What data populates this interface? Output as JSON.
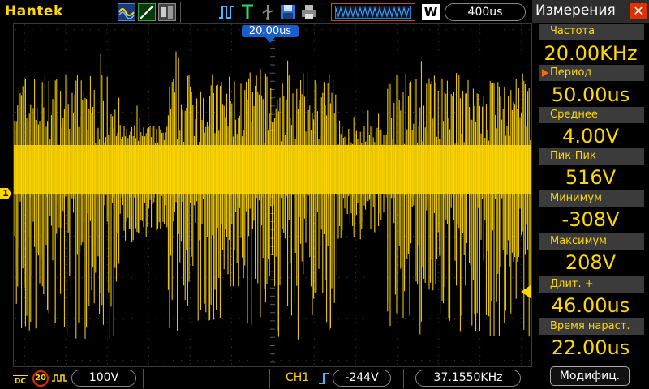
{
  "header": {
    "brand": "Hantek",
    "timebase": "400us",
    "window_mode_badge": "W"
  },
  "trigger": {
    "position_label": "20.00us"
  },
  "channel": {
    "marker_label": "1",
    "color": "#ffd800"
  },
  "measurements": {
    "title": "Измерения",
    "close_label": "✕",
    "items": [
      {
        "label": "Частота",
        "value": "20.00KHz"
      },
      {
        "label": "Период",
        "value": "50.00us"
      },
      {
        "label": "Среднее",
        "value": "4.00V"
      },
      {
        "label": "Пик-Пик",
        "value": "516V"
      },
      {
        "label": "Минимум",
        "value": "-308V"
      },
      {
        "label": "Максимум",
        "value": "208V"
      },
      {
        "label": "Длит.  +",
        "value": "46.00us"
      },
      {
        "label": "Время  нараст.",
        "value": "22.00us"
      }
    ],
    "modify_label": "Модифиц."
  },
  "status": {
    "coupling_label": "DC",
    "bw_limit_label": "20",
    "volts_per_div": "100V",
    "trigger_channel": "CH1",
    "trigger_level": "-244V",
    "trigger_frequency": "37.1550KHz"
  },
  "icons": {
    "run_mode": "run-mode-icon",
    "trigger_type": "trigger-edge-icon",
    "save": "floppy-icon",
    "print": "printer-icon"
  },
  "colors": {
    "trace": "#ffd800",
    "accent": "#1a5fc8",
    "close": "#e03000"
  }
}
